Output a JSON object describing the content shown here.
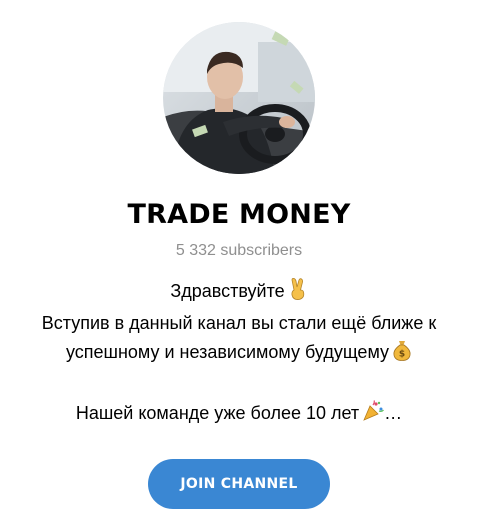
{
  "channel": {
    "title": "TRADE MONEY",
    "subscribers": "5 332 subscribers",
    "avatar_icon": "channel-avatar-photo"
  },
  "description": {
    "line1": "Здравствуйте",
    "line1_emoji": "victory-hand-icon",
    "line2": "Вступив в данный канал вы стали ещё ближе к",
    "line3": "успешному и независимому будущему",
    "line3_emoji": "money-bag-icon",
    "line4": "Нашей команде уже более 10 лет",
    "line4_emoji": "party-popper-icon",
    "line4_suffix": "…"
  },
  "actions": {
    "join_label": "JOIN CHANNEL"
  },
  "colors": {
    "accent": "#3a87d3",
    "subtitle": "#8f8f8f",
    "text": "#000000"
  }
}
